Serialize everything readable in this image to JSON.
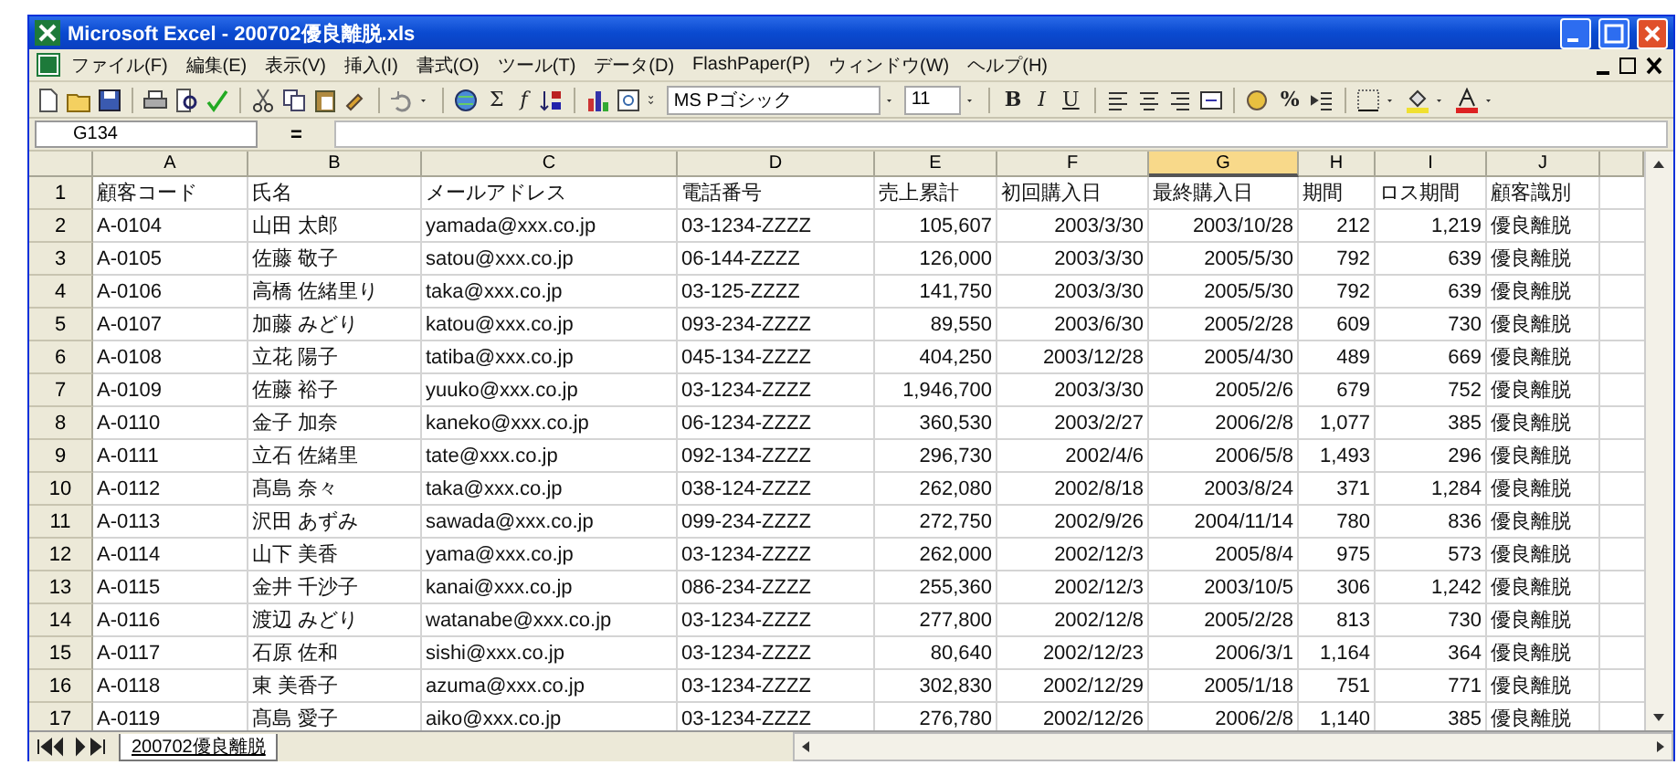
{
  "window": {
    "title": "Microsoft Excel - 200702優良離脱.xls"
  },
  "menu": [
    "ファイル(F)",
    "編集(E)",
    "表示(V)",
    "挿入(I)",
    "書式(O)",
    "ツール(T)",
    "データ(D)",
    "FlashPaper(P)",
    "ウィンドウ(W)",
    "ヘルプ(H)"
  ],
  "toolbar": {
    "sum": "Σ",
    "function": "f",
    "font": "MS Pゴシック",
    "font_size": "11",
    "bold": "B",
    "italic": "I",
    "underline": "U",
    "percent": "%"
  },
  "formula_bar": {
    "name_box": "G134",
    "equals": "="
  },
  "columns": [
    {
      "label": "A",
      "kind": "text",
      "selected": false
    },
    {
      "label": "B",
      "kind": "text",
      "selected": false
    },
    {
      "label": "C",
      "kind": "text",
      "selected": false
    },
    {
      "label": "D",
      "kind": "text",
      "selected": false
    },
    {
      "label": "E",
      "kind": "number",
      "selected": false
    },
    {
      "label": "F",
      "kind": "number",
      "selected": false
    },
    {
      "label": "G",
      "kind": "number",
      "selected": true
    },
    {
      "label": "H",
      "kind": "number",
      "selected": false
    },
    {
      "label": "I",
      "kind": "number",
      "selected": false
    },
    {
      "label": "J",
      "kind": "text",
      "selected": false
    }
  ],
  "rows": [
    {
      "number": "1",
      "cells": [
        "顧客コード",
        "氏名",
        "メールアドレス",
        "電話番号",
        "売上累計",
        "初回購入日",
        "最終購入日",
        "期間",
        "ロス期間",
        "顧客識別"
      ],
      "kind": "header"
    },
    {
      "number": "2",
      "cells": [
        "A-0104",
        "山田 太郎",
        "yamada@xxx.co.jp",
        "03-1234-ZZZZ",
        "105,607",
        "2003/3/30",
        "2003/10/28",
        "212",
        "1,219",
        "優良離脱"
      ],
      "kind": "data"
    },
    {
      "number": "3",
      "cells": [
        "A-0105",
        "佐藤 敬子",
        "satou@xxx.co.jp",
        "06-144-ZZZZ",
        "126,000",
        "2003/3/30",
        "2005/5/30",
        "792",
        "639",
        "優良離脱"
      ],
      "kind": "data"
    },
    {
      "number": "4",
      "cells": [
        "A-0106",
        "高橋 佐緒里り",
        "taka@xxx.co.jp",
        "03-125-ZZZZ",
        "141,750",
        "2003/3/30",
        "2005/5/30",
        "792",
        "639",
        "優良離脱"
      ],
      "kind": "data"
    },
    {
      "number": "5",
      "cells": [
        "A-0107",
        "加藤 みどり",
        "katou@xxx.co.jp",
        "093-234-ZZZZ",
        "89,550",
        "2003/6/30",
        "2005/2/28",
        "609",
        "730",
        "優良離脱"
      ],
      "kind": "data"
    },
    {
      "number": "6",
      "cells": [
        "A-0108",
        "立花 陽子",
        "tatiba@xxx.co.jp",
        "045-134-ZZZZ",
        "404,250",
        "2003/12/28",
        "2005/4/30",
        "489",
        "669",
        "優良離脱"
      ],
      "kind": "data"
    },
    {
      "number": "7",
      "cells": [
        "A-0109",
        "佐藤 裕子",
        "yuuko@xxx.co.jp",
        "03-1234-ZZZZ",
        "1,946,700",
        "2003/3/30",
        "2005/2/6",
        "679",
        "752",
        "優良離脱"
      ],
      "kind": "data"
    },
    {
      "number": "8",
      "cells": [
        "A-0110",
        "金子 加奈",
        "kaneko@xxx.co.jp",
        "06-1234-ZZZZ",
        "360,530",
        "2003/2/27",
        "2006/2/8",
        "1,077",
        "385",
        "優良離脱"
      ],
      "kind": "data"
    },
    {
      "number": "9",
      "cells": [
        "A-0111",
        "立石 佐緒里",
        "tate@xxx.co.jp",
        "092-134-ZZZZ",
        "296,730",
        "2002/4/6",
        "2006/5/8",
        "1,493",
        "296",
        "優良離脱"
      ],
      "kind": "data"
    },
    {
      "number": "10",
      "cells": [
        "A-0112",
        "髙島 奈々",
        "taka@xxx.co.jp",
        "038-124-ZZZZ",
        "262,080",
        "2002/8/18",
        "2003/8/24",
        "371",
        "1,284",
        "優良離脱"
      ],
      "kind": "data"
    },
    {
      "number": "11",
      "cells": [
        "A-0113",
        "沢田 あずみ",
        "sawada@xxx.co.jp",
        "099-234-ZZZZ",
        "272,750",
        "2002/9/26",
        "2004/11/14",
        "780",
        "836",
        "優良離脱"
      ],
      "kind": "data"
    },
    {
      "number": "12",
      "cells": [
        "A-0114",
        "山下 美香",
        "yama@xxx.co.jp",
        "03-1234-ZZZZ",
        "262,000",
        "2002/12/3",
        "2005/8/4",
        "975",
        "573",
        "優良離脱"
      ],
      "kind": "data"
    },
    {
      "number": "13",
      "cells": [
        "A-0115",
        "金井 千沙子",
        "kanai@xxx.co.jp",
        "086-234-ZZZZ",
        "255,360",
        "2002/12/3",
        "2003/10/5",
        "306",
        "1,242",
        "優良離脱"
      ],
      "kind": "data"
    },
    {
      "number": "14",
      "cells": [
        "A-0116",
        "渡辺 みどり",
        "watanabe@xxx.co.jp",
        "03-1234-ZZZZ",
        "277,800",
        "2002/12/8",
        "2005/2/28",
        "813",
        "730",
        "優良離脱"
      ],
      "kind": "data"
    },
    {
      "number": "15",
      "cells": [
        "A-0117",
        "石原 佐和",
        "sishi@xxx.co.jp",
        "03-1234-ZZZZ",
        "80,640",
        "2002/12/23",
        "2006/3/1",
        "1,164",
        "364",
        "優良離脱"
      ],
      "kind": "data"
    },
    {
      "number": "16",
      "cells": [
        "A-0118",
        "東 美香子",
        "azuma@xxx.co.jp",
        "03-1234-ZZZZ",
        "302,830",
        "2002/12/29",
        "2005/1/18",
        "751",
        "771",
        "優良離脱"
      ],
      "kind": "data"
    },
    {
      "number": "17",
      "cells": [
        "A-0119",
        "髙島 愛子",
        "aiko@xxx.co.jp",
        "03-1234-ZZZZ",
        "276,780",
        "2002/12/26",
        "2006/2/8",
        "1,140",
        "385",
        "優良離脱"
      ],
      "kind": "data"
    }
  ],
  "sheet_tabs": [
    {
      "label": "200702優良離脱",
      "selected": true
    }
  ]
}
